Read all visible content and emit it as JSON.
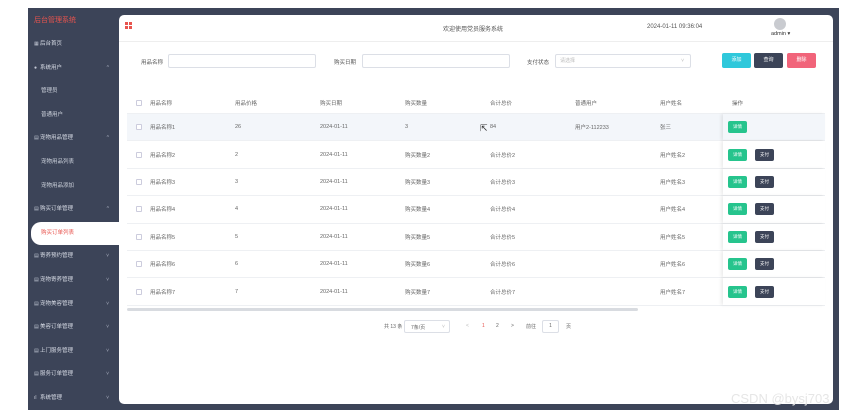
{
  "app": {
    "title": "后台管理系统",
    "system_name": "欢迎使用党员服务系统",
    "datetime": "2024-01-11 09:36:04",
    "user": "admin ▾"
  },
  "sidebar": {
    "items": [
      {
        "icon": "home-icon",
        "glyph": "▦",
        "label": "后台首页",
        "chevron": ""
      },
      {
        "icon": "user-icon",
        "glyph": "●",
        "label": "系统用户",
        "chevron": "^"
      },
      {
        "icon": "",
        "glyph": "",
        "label": "管理员",
        "chevron": "",
        "sub": true
      },
      {
        "icon": "",
        "glyph": "",
        "label": "普通用户",
        "chevron": "",
        "sub": true
      },
      {
        "icon": "folder-icon",
        "glyph": "▤",
        "label": "宠物用品管理",
        "chevron": "^"
      },
      {
        "icon": "",
        "glyph": "",
        "label": "宠物用品列表",
        "chevron": "",
        "sub": true
      },
      {
        "icon": "",
        "glyph": "",
        "label": "宠物用品添加",
        "chevron": "",
        "sub": true
      },
      {
        "icon": "folder-icon",
        "glyph": "▤",
        "label": "购买订单管理",
        "chevron": "^"
      },
      {
        "icon": "",
        "glyph": "",
        "label": "购买订单列表",
        "chevron": "",
        "sub": true,
        "active": true
      },
      {
        "icon": "folder-icon",
        "glyph": "▤",
        "label": "寄养预约管理",
        "chevron": "˅"
      },
      {
        "icon": "folder-icon",
        "glyph": "▤",
        "label": "宠物寄养管理",
        "chevron": "˅"
      },
      {
        "icon": "folder-icon",
        "glyph": "▤",
        "label": "宠物美容管理",
        "chevron": "˅"
      },
      {
        "icon": "folder-icon",
        "glyph": "▤",
        "label": "美容订单管理",
        "chevron": "˅"
      },
      {
        "icon": "folder-icon",
        "glyph": "▤",
        "label": "上门服务管理",
        "chevron": "˅"
      },
      {
        "icon": "folder-icon",
        "glyph": "▤",
        "label": "服务订单管理",
        "chevron": "˅"
      },
      {
        "icon": "chart-icon",
        "glyph": "ıl",
        "label": "系统管理",
        "chevron": "˅"
      }
    ]
  },
  "search": {
    "name_label": "用品名称",
    "date_label": "购买日期",
    "status_label": "支付状态",
    "status_placeholder": "请选择",
    "add": "添加",
    "query": "查询",
    "delete": "删除"
  },
  "table": {
    "headers": [
      "用品名称",
      "用品价格",
      "购买日期",
      "购买数量",
      "合计总价",
      "普通用户",
      "用户姓名",
      "操作"
    ],
    "rows": [
      {
        "name": "用品名称1",
        "price": "26",
        "date": "2024-01-11",
        "qty": "3",
        "total": "84",
        "user": "用户2-112233",
        "uname": "张三",
        "pay": false
      },
      {
        "name": "用品名称2",
        "price": "2",
        "date": "2024-01-11",
        "qty": "购买数量2",
        "total": "合计总价2",
        "user": "",
        "uname": "用户姓名2",
        "pay": true
      },
      {
        "name": "用品名称3",
        "price": "3",
        "date": "2024-01-11",
        "qty": "购买数量3",
        "total": "合计总价3",
        "user": "",
        "uname": "用户姓名3",
        "pay": true
      },
      {
        "name": "用品名称4",
        "price": "4",
        "date": "2024-01-11",
        "qty": "购买数量4",
        "total": "合计总价4",
        "user": "",
        "uname": "用户姓名4",
        "pay": true
      },
      {
        "name": "用品名称5",
        "price": "5",
        "date": "2024-01-11",
        "qty": "购买数量5",
        "total": "合计总价5",
        "user": "",
        "uname": "用户姓名5",
        "pay": true
      },
      {
        "name": "用品名称6",
        "price": "6",
        "date": "2024-01-11",
        "qty": "购买数量6",
        "total": "合计总价6",
        "user": "",
        "uname": "用户姓名6",
        "pay": true
      },
      {
        "name": "用品名称7",
        "price": "7",
        "date": "2024-01-11",
        "qty": "购买数量7",
        "total": "合计总价7",
        "user": "",
        "uname": "用户姓名7",
        "pay": true
      }
    ],
    "detail": "详情",
    "pay": "支付"
  },
  "pager": {
    "total": "共 13 条",
    "page_size": "7条/页",
    "prev": "<",
    "page1": "1",
    "page2": "2",
    "next": ">",
    "goto": "前往",
    "goto_value": "1",
    "page_unit": "页"
  },
  "watermark": "CSDN @bysj703"
}
